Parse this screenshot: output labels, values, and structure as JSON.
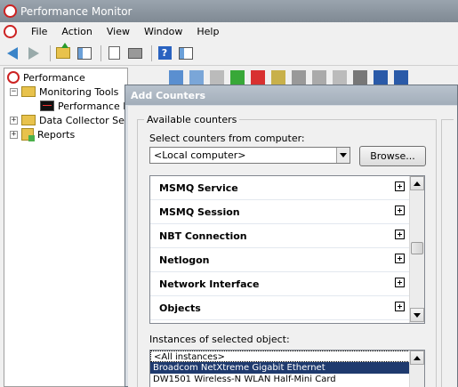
{
  "window": {
    "title": "Performance Monitor"
  },
  "menu": {
    "items": [
      "File",
      "Action",
      "View",
      "Window",
      "Help"
    ]
  },
  "tree": {
    "items": [
      {
        "label": "Performance"
      },
      {
        "label": "Monitoring Tools"
      },
      {
        "label": "Performance Mo"
      },
      {
        "label": "Data Collector Sets"
      },
      {
        "label": "Reports"
      }
    ]
  },
  "dialog": {
    "title": "Add Counters",
    "group_label": "Available counters",
    "computer_label": "Select counters from computer:",
    "computer_value": "<Local computer>",
    "browse_label": "Browse...",
    "counters": [
      "MSMQ Service",
      "MSMQ Session",
      "NBT Connection",
      "Netlogon",
      "Network Interface",
      "Objects"
    ],
    "instances_label": "Instances of selected object:",
    "instances": [
      "<All instances>",
      "Broadcom NetXtreme Gigabit Ethernet",
      "DW1501 Wireless-N WLAN Half-Mini Card"
    ],
    "selected_instance_index": 1
  },
  "colors": {
    "selection": "#1f3a6e",
    "title_bar": "#8a949e"
  }
}
